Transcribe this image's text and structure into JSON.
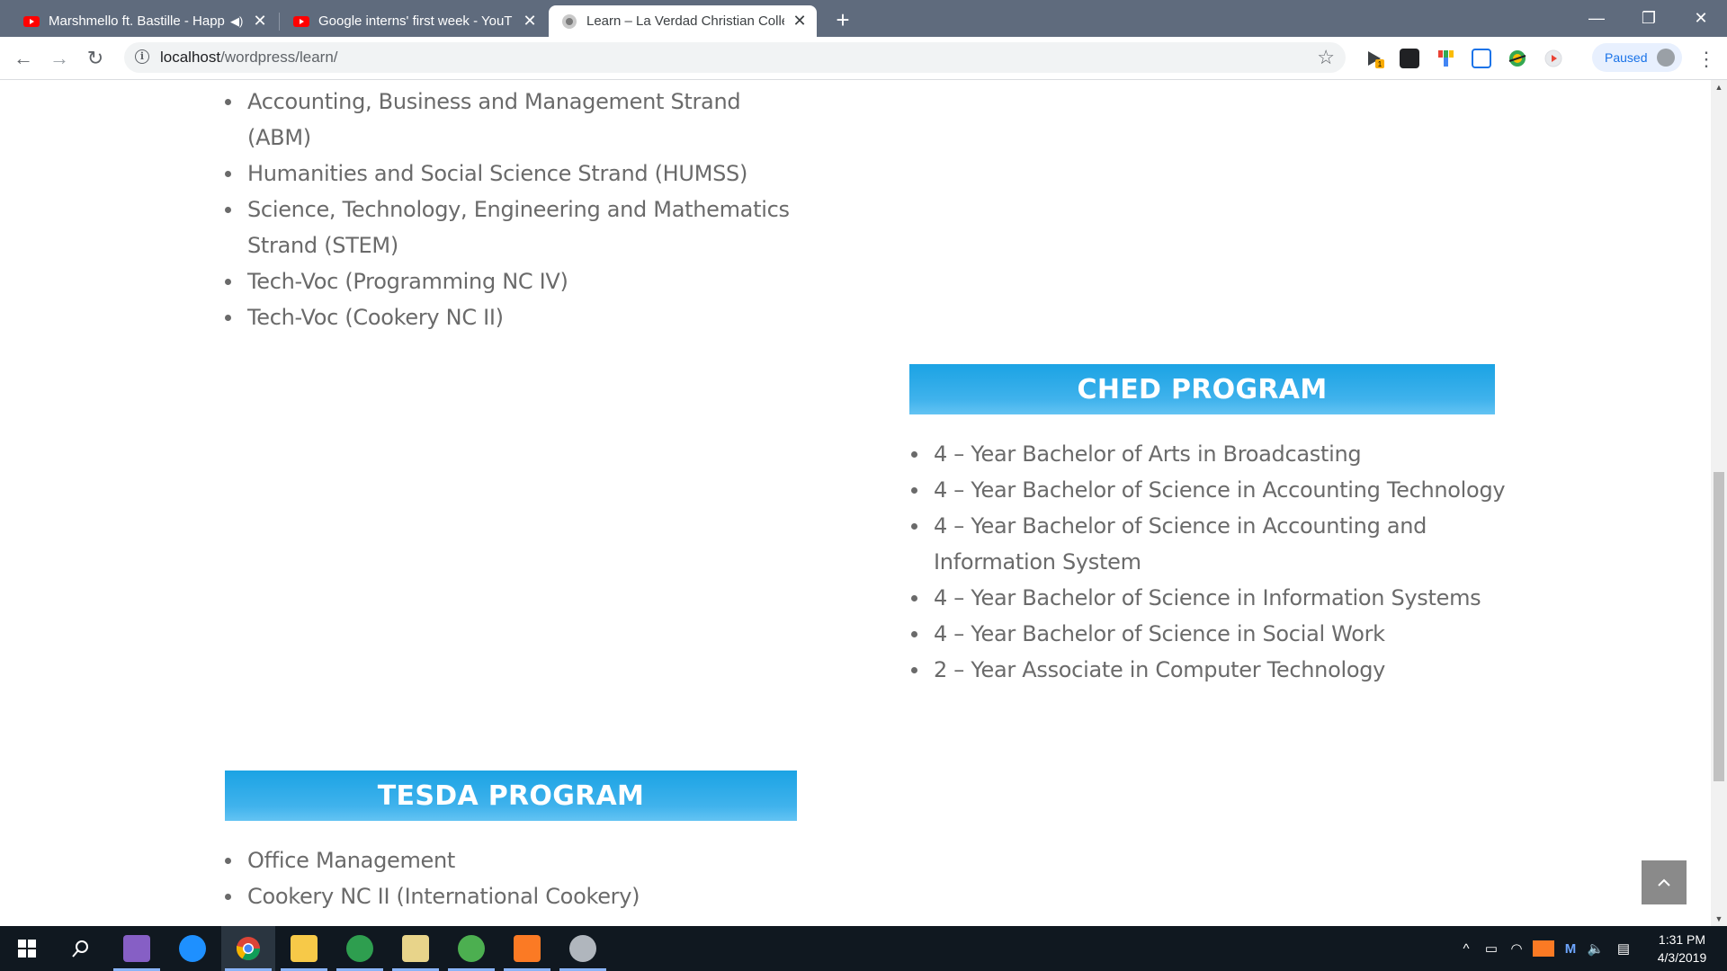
{
  "browser": {
    "tabs": [
      {
        "title": "Marshmello ft. Bastille - Happ",
        "icon": "youtube-icon",
        "audio": true,
        "active": false
      },
      {
        "title": "Google interns' first week - YouT",
        "icon": "youtube-icon",
        "audio": false,
        "active": false
      },
      {
        "title": "Learn – La Verdad Christian Colle",
        "icon": "site-icon",
        "audio": false,
        "active": true
      }
    ],
    "new_tab_glyph": "+",
    "url_host": "localhost",
    "url_path": "/wordpress/learn/",
    "profile_status": "Paused",
    "extension_badge": "1"
  },
  "page": {
    "shs_strands": [
      "Accounting, Business and Management Strand (ABM)",
      "Humanities and Social Science Strand (HUMSS)",
      "Science, Technology, Engineering and Mathematics Strand (STEM)",
      "Tech-Voc (Programming NC IV)",
      "Tech-Voc (Cookery NC II)"
    ],
    "ched": {
      "heading": "CHED PROGRAM",
      "items": [
        "4 – Year Bachelor of Arts in Broadcasting",
        "4 – Year Bachelor of Science in Accounting Technology",
        "4 – Year Bachelor of Science in Accounting and Information System",
        "4 – Year Bachelor of Science in Information Systems",
        "4 – Year Bachelor of Science in Social Work",
        "2 – Year Associate in Computer Technology"
      ]
    },
    "tesda": {
      "heading": "TESDA PROGRAM",
      "items": [
        "Office Management",
        "Cookery NC II (International Cookery)"
      ]
    },
    "scroll_top_icon": "chevron-up-icon"
  },
  "taskbar": {
    "apps": [
      "windows-start-icon",
      "search-icon",
      "visual-studio-icon",
      "app-m-icon",
      "chrome-icon",
      "file-explorer-icon",
      "app-globe-icon",
      "folder-icon",
      "utorrent-icon",
      "xampp-icon",
      "app-disc-icon"
    ],
    "clock_time": "1:31 PM",
    "clock_date": "4/3/2019"
  },
  "colors": {
    "banner": "#1ba3e4",
    "body_text": "#6a6a6a",
    "tabstrip": "#5f6b7d"
  }
}
